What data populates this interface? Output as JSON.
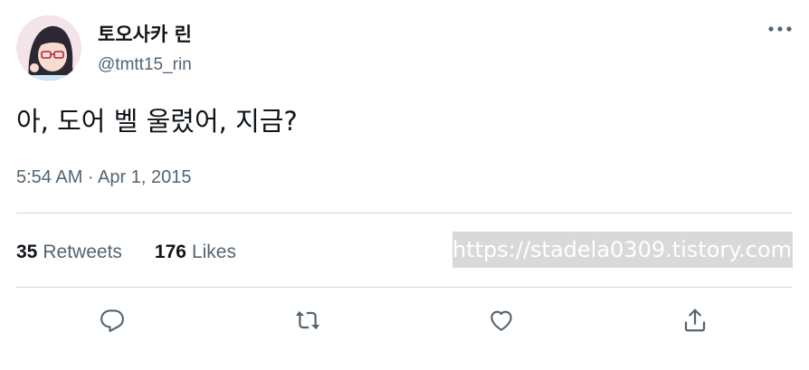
{
  "user": {
    "display_name": "토오사카 린",
    "handle": "@tmtt15_rin"
  },
  "tweet": {
    "text": "아, 도어 벨 울렸어, 지금?",
    "timestamp": "5:54 AM · Apr 1, 2015"
  },
  "stats": {
    "retweets_count": "35",
    "retweets_label": "Retweets",
    "likes_count": "176",
    "likes_label": "Likes"
  },
  "watermark": "https://stadela0309.tistory.com",
  "icons": {
    "more": "more-horizontal-icon",
    "reply": "reply-icon",
    "retweet": "retweet-icon",
    "like": "heart-icon",
    "share": "share-icon"
  },
  "colors": {
    "text_primary": "#0f1419",
    "text_secondary": "#536471",
    "divider": "#cfd9de",
    "watermark_bg": "#d9d9d9"
  }
}
